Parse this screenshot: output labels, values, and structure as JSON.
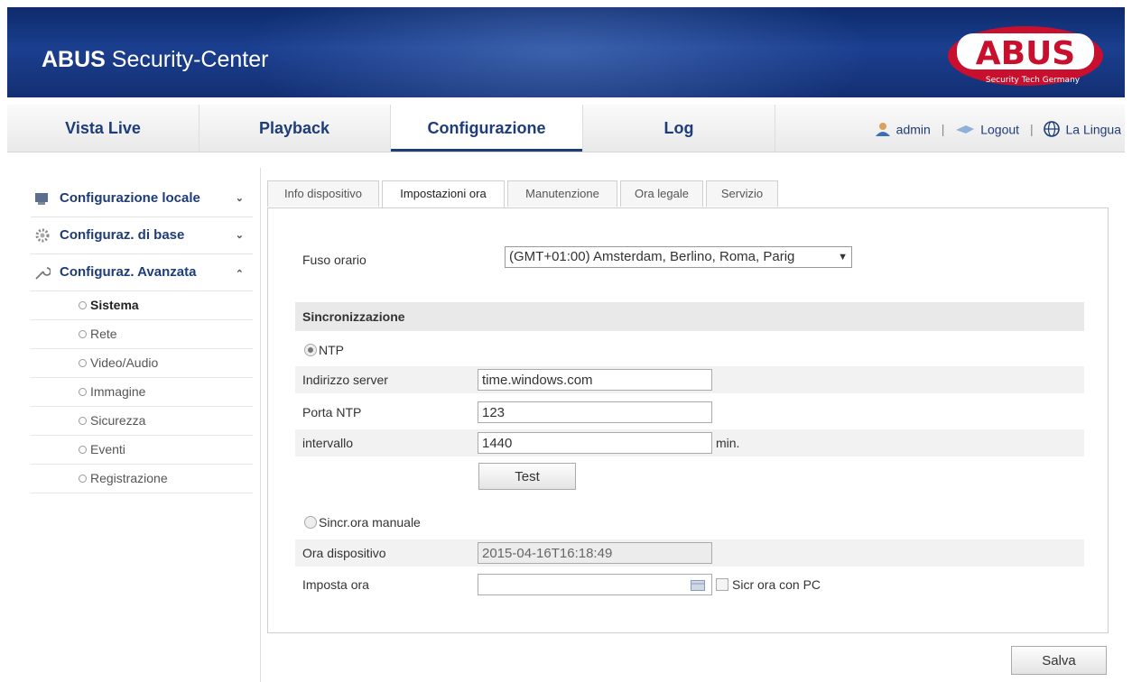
{
  "header": {
    "title_bold": "ABUS",
    "title_rest": " Security-Center",
    "logo_text": "ABUS",
    "logo_tagline": "Security Tech Germany",
    "colors": {
      "banner": "#1b3f8f",
      "logo_red": "#c8102e"
    }
  },
  "nav": {
    "tabs": [
      {
        "label": "Vista Live"
      },
      {
        "label": "Playback"
      },
      {
        "label": "Configurazione",
        "active": true
      },
      {
        "label": "Log"
      }
    ],
    "user": "admin",
    "logout": "Logout",
    "language": "La Lingua",
    "separator": "|"
  },
  "sidebar": {
    "groups": [
      {
        "label": "Configurazione locale",
        "icon": "monitor-icon",
        "expanded": false
      },
      {
        "label": "Configuraz. di base",
        "icon": "gear-icon",
        "expanded": false
      },
      {
        "label": "Configuraz. Avanzata",
        "icon": "wrench-icon",
        "expanded": true
      }
    ],
    "items": [
      {
        "label": "Sistema",
        "active": true
      },
      {
        "label": "Rete"
      },
      {
        "label": "Video/Audio"
      },
      {
        "label": "Immagine"
      },
      {
        "label": "Sicurezza"
      },
      {
        "label": "Eventi"
      },
      {
        "label": "Registrazione"
      }
    ]
  },
  "subtabs": [
    {
      "label": "Info dispositivo"
    },
    {
      "label": "Impostazioni ora",
      "active": true
    },
    {
      "label": "Manutenzione"
    },
    {
      "label": "Ora legale"
    },
    {
      "label": "Servizio"
    }
  ],
  "form": {
    "timezone_label": "Fuso orario",
    "timezone_value": "(GMT+01:00) Amsterdam, Berlino, Roma, Parig",
    "sync_header": "Sincronizzazione",
    "ntp_label": "NTP",
    "ntp_selected": true,
    "server_label": "Indirizzo server",
    "server_value": "time.windows.com",
    "port_label": "Porta NTP",
    "port_value": "123",
    "interval_label": "intervallo",
    "interval_value": "1440",
    "interval_unit": "min.",
    "test_button": "Test",
    "manual_label": "Sincr.ora manuale",
    "device_time_label": "Ora dispositivo",
    "device_time_value": "2015-04-16T16:18:49",
    "set_time_label": "Imposta ora",
    "set_time_value": "",
    "sync_pc_label": "Sicr ora con PC"
  },
  "save_button": "Salva"
}
